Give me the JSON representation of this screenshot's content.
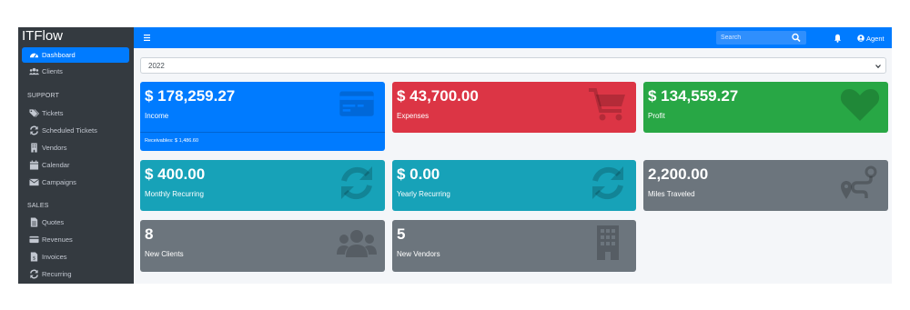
{
  "app": {
    "brand": "ITFlow"
  },
  "sidebar": {
    "items": [
      {
        "label": "Dashboard",
        "icon": "dashboard-icon"
      },
      {
        "label": "Clients",
        "icon": "users-icon"
      }
    ],
    "support": {
      "header": "SUPPORT",
      "items": [
        {
          "label": "Tickets",
          "icon": "tags-icon"
        },
        {
          "label": "Scheduled Tickets",
          "icon": "sync-icon"
        },
        {
          "label": "Vendors",
          "icon": "building-icon"
        },
        {
          "label": "Calendar",
          "icon": "calendar-icon"
        },
        {
          "label": "Campaigns",
          "icon": "envelope-icon"
        }
      ]
    },
    "sales": {
      "header": "SALES",
      "items": [
        {
          "label": "Quotes",
          "icon": "file-icon"
        },
        {
          "label": "Revenues",
          "icon": "credit-card-icon"
        },
        {
          "label": "Invoices",
          "icon": "invoice-icon"
        },
        {
          "label": "Recurring",
          "icon": "sync-icon"
        }
      ]
    }
  },
  "navbar": {
    "search_placeholder": "Search",
    "user_label": "Agent"
  },
  "filter": {
    "year": "2022"
  },
  "cards": [
    {
      "value": "$ 178,259.27",
      "label": "Income",
      "footer": "Receivables: $ 1,486.60",
      "icon": "credit-card-icon",
      "color": "#007bff"
    },
    {
      "value": "$ 43,700.00",
      "label": "Expenses",
      "icon": "shopping-cart-icon",
      "color": "#dc3545"
    },
    {
      "value": "$ 134,559.27",
      "label": "Profit",
      "icon": "heart-icon",
      "color": "#28a745"
    },
    {
      "value": "$ 400.00",
      "label": "Monthly Recurring",
      "icon": "sync-icon",
      "color": "#17a2b8"
    },
    {
      "value": "$ 0.00",
      "label": "Yearly Recurring",
      "icon": "sync-icon",
      "color": "#17a2b8"
    },
    {
      "value": "2,200.00",
      "label": "Miles Traveled",
      "icon": "route-icon",
      "color": "#6c757d"
    },
    {
      "value": "8",
      "label": "New Clients",
      "icon": "users-icon",
      "color": "#6c757d"
    },
    {
      "value": "5",
      "label": "New Vendors",
      "icon": "building-icon",
      "color": "#6c757d"
    }
  ]
}
